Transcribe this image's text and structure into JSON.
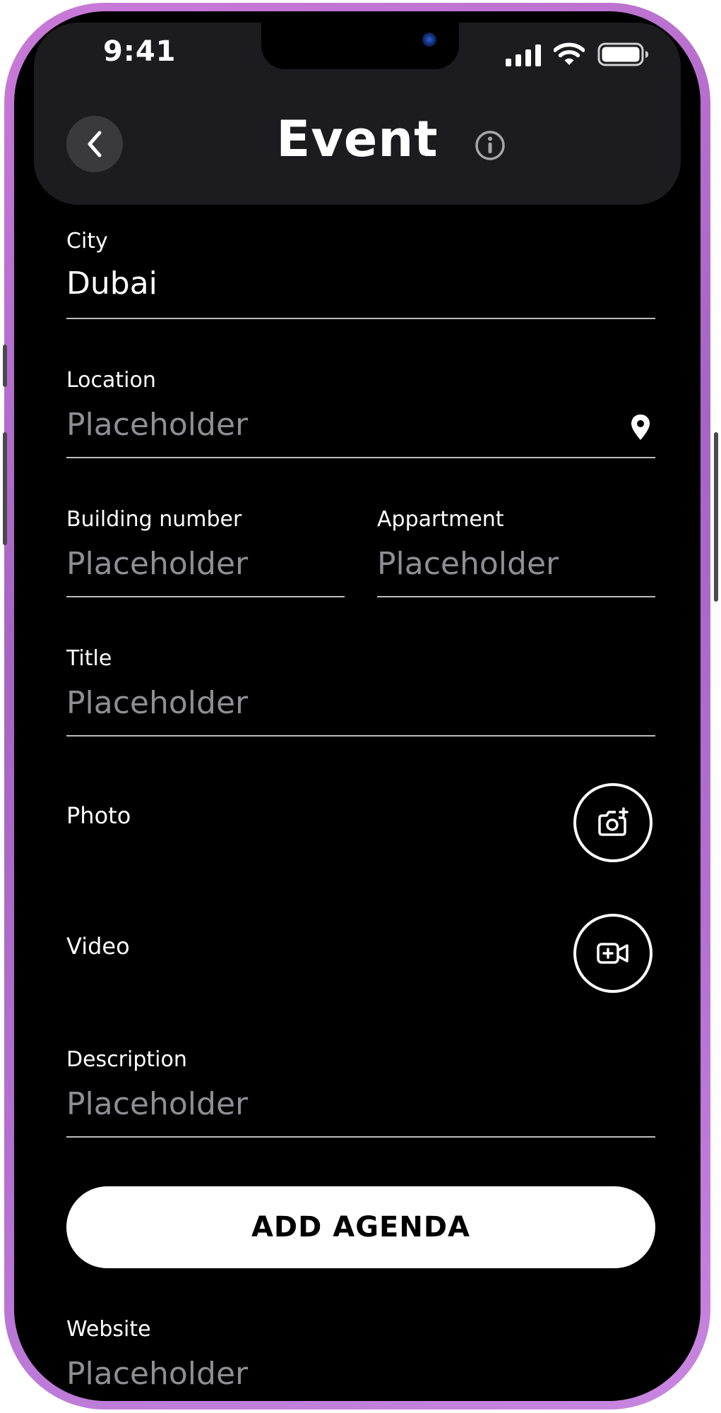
{
  "status_bar": {
    "time": "9:41",
    "icons": [
      "cellular-signal-icon",
      "wifi-icon",
      "battery-icon"
    ]
  },
  "header": {
    "title": "Event",
    "back_icon": "chevron-left-icon",
    "info_icon": "info-icon"
  },
  "form": {
    "city": {
      "label": "City",
      "value": "Dubai"
    },
    "location": {
      "label": "Location",
      "placeholder": "Placeholder",
      "icon": "location-pin-icon"
    },
    "building_number": {
      "label": "Building number",
      "placeholder": "Placeholder"
    },
    "apartment": {
      "label": "Appartment",
      "placeholder": "Placeholder"
    },
    "title": {
      "label": "Title",
      "placeholder": "Placeholder"
    },
    "photo": {
      "label": "Photo",
      "icon": "add-photo-icon"
    },
    "video": {
      "label": "Video",
      "icon": "add-video-icon"
    },
    "description": {
      "label": "Description",
      "placeholder": "Placeholder"
    },
    "website": {
      "label": "Website",
      "placeholder": "Placeholder"
    }
  },
  "actions": {
    "add_agenda_label": "ADD AGENDA"
  },
  "colors": {
    "frame": "#b86fd2",
    "background": "#000000",
    "header_card": "#1c1c1e",
    "text_primary": "#ffffff",
    "placeholder": "#8e8e93",
    "divider": "#bdbdbd",
    "button_bg": "#ffffff",
    "button_text": "#000000"
  }
}
